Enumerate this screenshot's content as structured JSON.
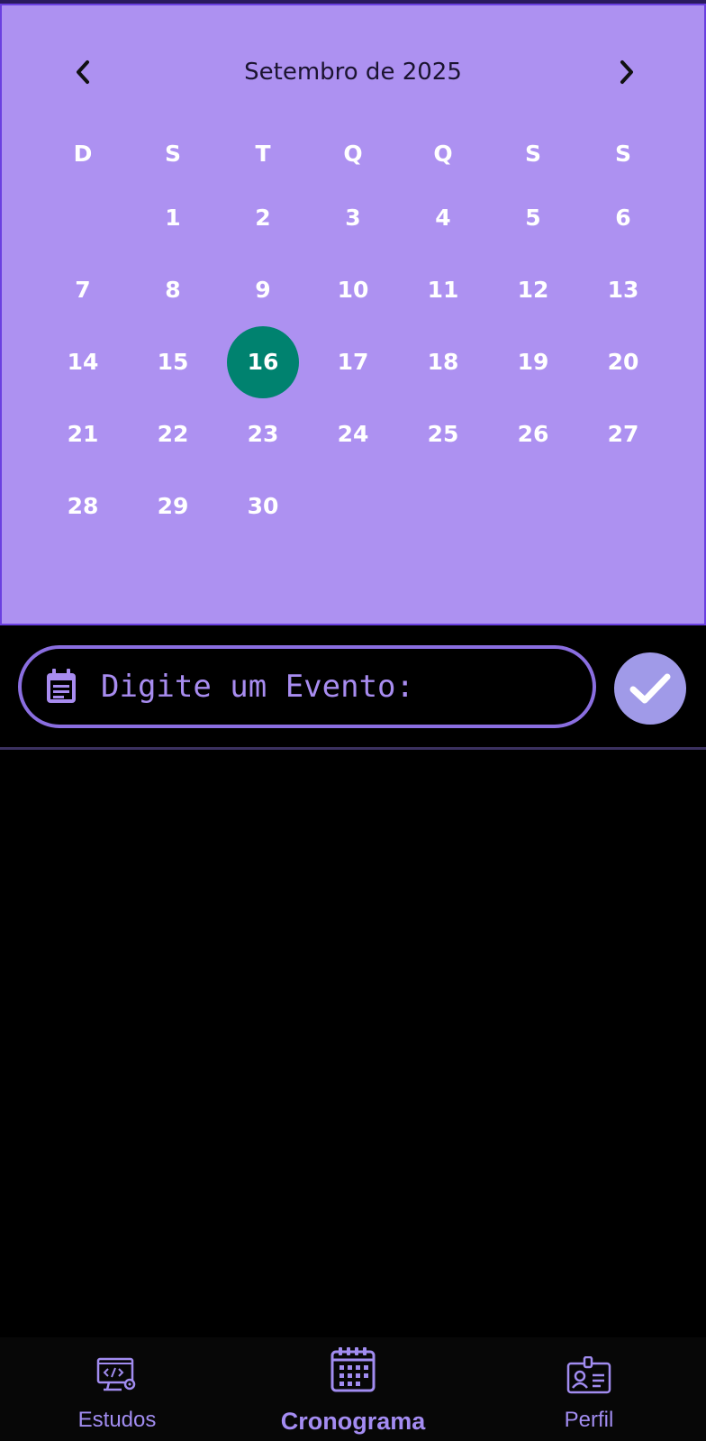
{
  "calendar": {
    "month_title": "Setembro de 2025",
    "weekdays": [
      "D",
      "S",
      "T",
      "Q",
      "Q",
      "S",
      "S"
    ],
    "weeks": [
      [
        "",
        "1",
        "2",
        "3",
        "4",
        "5",
        "6"
      ],
      [
        "7",
        "8",
        "9",
        "10",
        "11",
        "12",
        "13"
      ],
      [
        "14",
        "15",
        "16",
        "17",
        "18",
        "19",
        "20"
      ],
      [
        "21",
        "22",
        "23",
        "24",
        "25",
        "26",
        "27"
      ],
      [
        "28",
        "29",
        "30",
        "",
        "",
        "",
        ""
      ]
    ],
    "selected_day": "16",
    "prev_icon": "chevron-left-icon",
    "next_icon": "chevron-right-icon"
  },
  "event": {
    "placeholder": "Digite um Evento:",
    "value": "",
    "icon": "calendar-note-icon",
    "confirm_icon": "checkmark-icon"
  },
  "bottom_nav": {
    "items": [
      {
        "label": "Estudos",
        "icon": "computer-code-icon",
        "active": false
      },
      {
        "label": "Cronograma",
        "icon": "calendar-grid-icon",
        "active": true
      },
      {
        "label": "Perfil",
        "icon": "id-badge-icon",
        "active": false
      }
    ]
  },
  "colors": {
    "calendar_bg": "#ad91f1",
    "calendar_border": "#6a3fe0",
    "selected_day": "#00826f",
    "accent": "#8a6ee0",
    "confirm_bg": "#a09ae8",
    "background": "#000000"
  }
}
